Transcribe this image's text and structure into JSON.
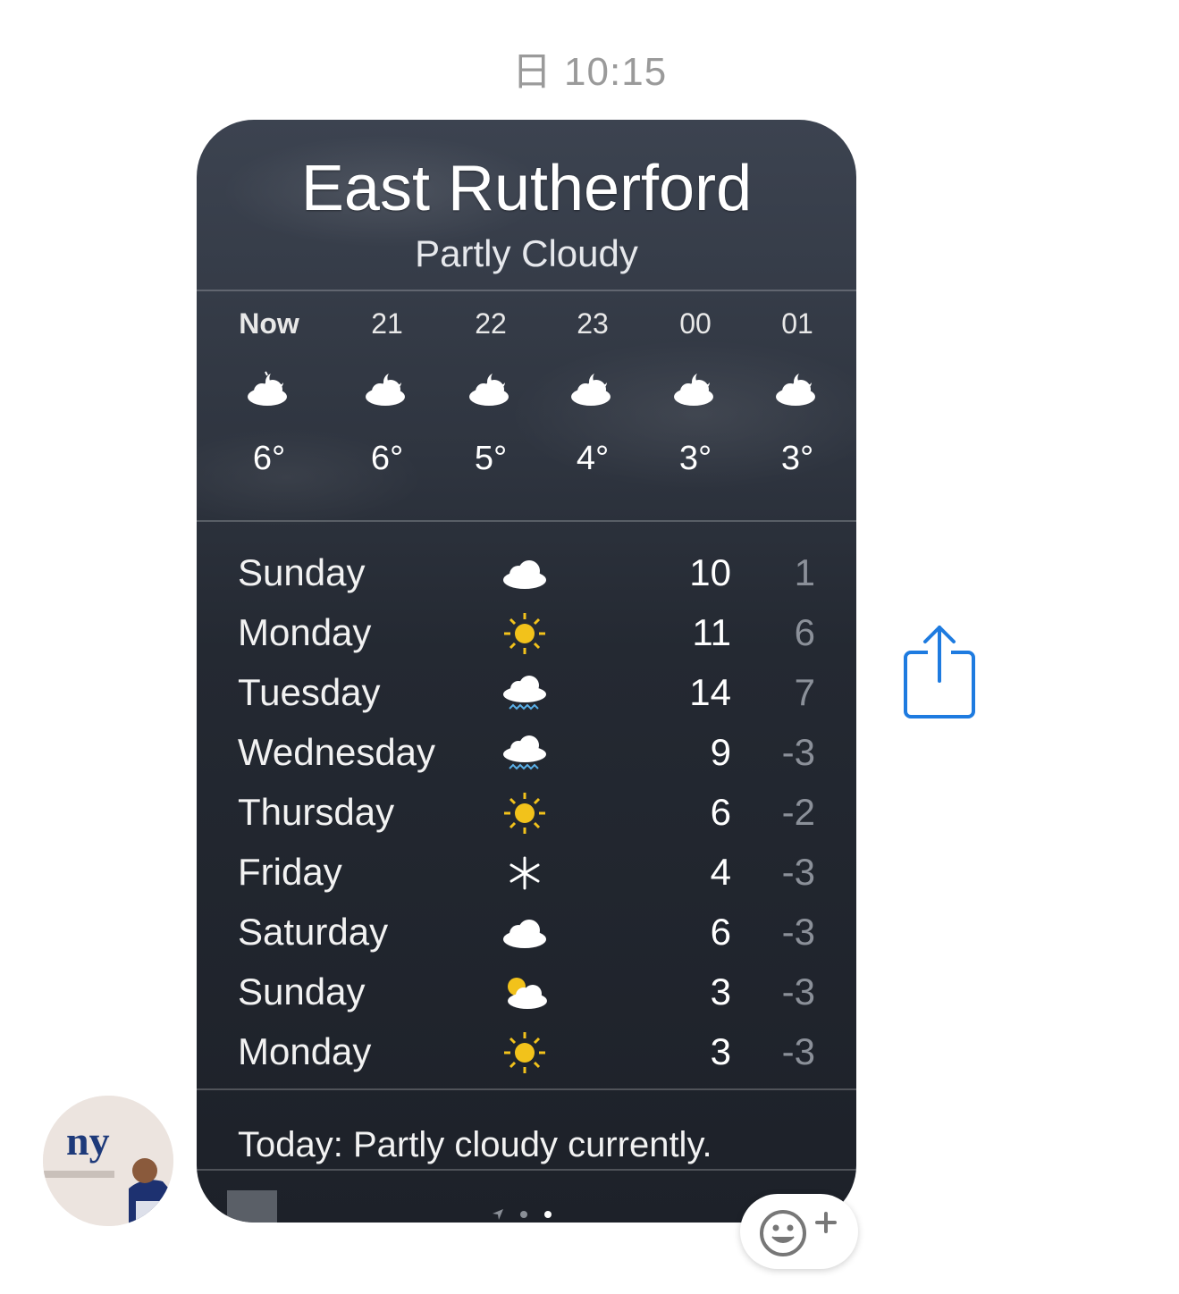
{
  "timestamp": "日 10:15",
  "card": {
    "city": "East Rutherford",
    "condition": "Partly Cloudy",
    "hourly": [
      {
        "label": "Now",
        "icon": "partly-cloudy-night-icon",
        "temp": "6°"
      },
      {
        "label": "21",
        "icon": "partly-cloudy-night-icon",
        "temp": "6°"
      },
      {
        "label": "22",
        "icon": "partly-cloudy-night-icon",
        "temp": "5°"
      },
      {
        "label": "23",
        "icon": "partly-cloudy-night-icon",
        "temp": "4°"
      },
      {
        "label": "00",
        "icon": "partly-cloudy-night-icon",
        "temp": "3°"
      },
      {
        "label": "01",
        "icon": "partly-cloudy-night-icon",
        "temp": "3°"
      }
    ],
    "daily": [
      {
        "day": "Sunday",
        "icon": "cloud-icon",
        "high": "10",
        "low": "1"
      },
      {
        "day": "Monday",
        "icon": "sun-icon",
        "high": "11",
        "low": "6"
      },
      {
        "day": "Tuesday",
        "icon": "rain-cloud-icon",
        "high": "14",
        "low": "7"
      },
      {
        "day": "Wednesday",
        "icon": "rain-cloud-icon",
        "high": "9",
        "low": "-3"
      },
      {
        "day": "Thursday",
        "icon": "sun-icon",
        "high": "6",
        "low": "-2"
      },
      {
        "day": "Friday",
        "icon": "snowflake-icon",
        "high": "4",
        "low": "-3"
      },
      {
        "day": "Saturday",
        "icon": "cloud-icon",
        "high": "6",
        "low": "-3"
      },
      {
        "day": "Sunday",
        "icon": "partly-cloudy-day-icon",
        "high": "3",
        "low": "-3"
      },
      {
        "day": "Monday",
        "icon": "sun-icon",
        "high": "3",
        "low": "-3"
      }
    ],
    "summary": "Today: Partly cloudy currently."
  },
  "colors": {
    "share_icon": "#1e7be0",
    "sun": "#f2c21b",
    "low_temp": "#8b9099"
  }
}
